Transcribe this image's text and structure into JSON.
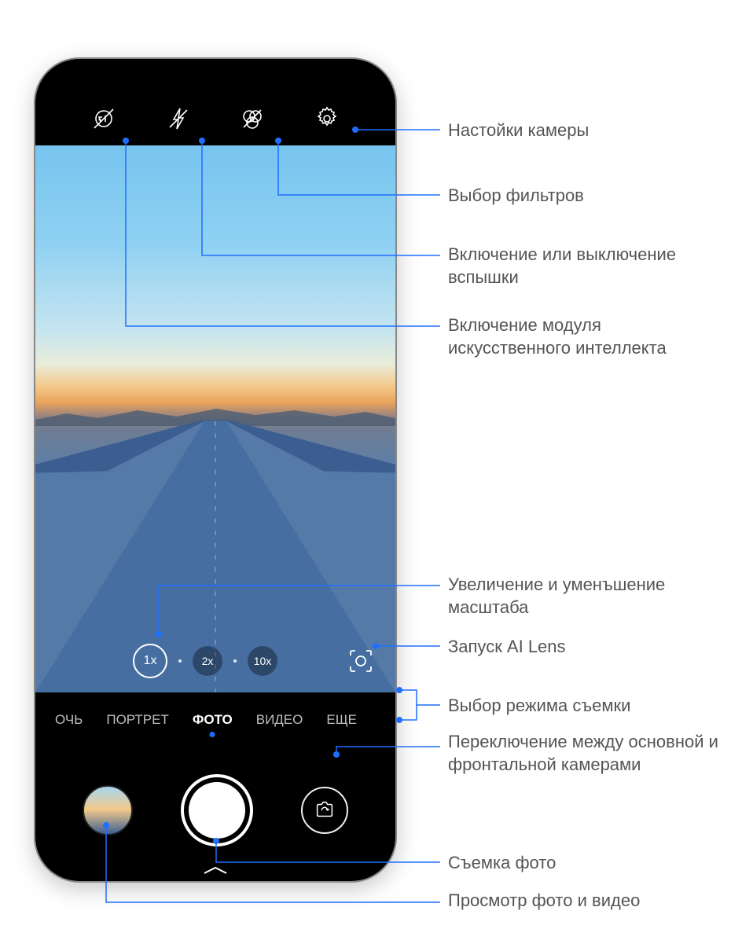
{
  "callouts": {
    "settings": "Настойки камеры",
    "filters": "Выбор фильтров",
    "flash": "Включение или выключение вспышки",
    "ai_module": "Включение модуля искусственного интеллекта",
    "zoom": "Увеличение и уменъшение масштаба",
    "ai_lens": "Запуск AI Lens",
    "mode_select": "Выбор режима съемки",
    "switch_cam": "Переключение между основной и фронтальной камерами",
    "shutter": "Съемка фото",
    "gallery": "Просмотр фото и видео"
  },
  "zoom": {
    "x1": "1x",
    "x2": "2x",
    "x10": "10x"
  },
  "modes": {
    "night": "ОЧЬ",
    "portrait": "ПОРТРЕТ",
    "photo": "ФОТО",
    "video": "ВИДЕО",
    "more": "ЕЩЕ"
  },
  "colors": {
    "accent": "#1e6fff"
  }
}
